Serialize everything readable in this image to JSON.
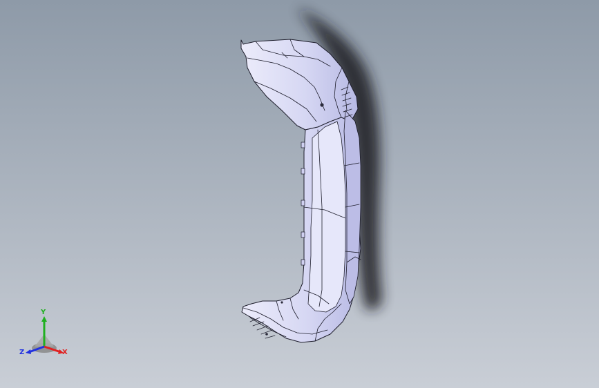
{
  "viewport": {
    "background_top": "#8e9aa8",
    "background_bottom": "#c9ced6",
    "part_color": "#d9daf3",
    "part_shadow_color": "#b9bbe6",
    "edge_color": "#1c1c2a",
    "drop_shadow_color": "#1e1e22"
  },
  "triad": {
    "icon": "coordinate-triad-icon",
    "x_label": "X",
    "y_label": "Y",
    "z_label": "Z",
    "x_color": "#e02020",
    "y_color": "#20b020",
    "z_color": "#2030e0"
  }
}
